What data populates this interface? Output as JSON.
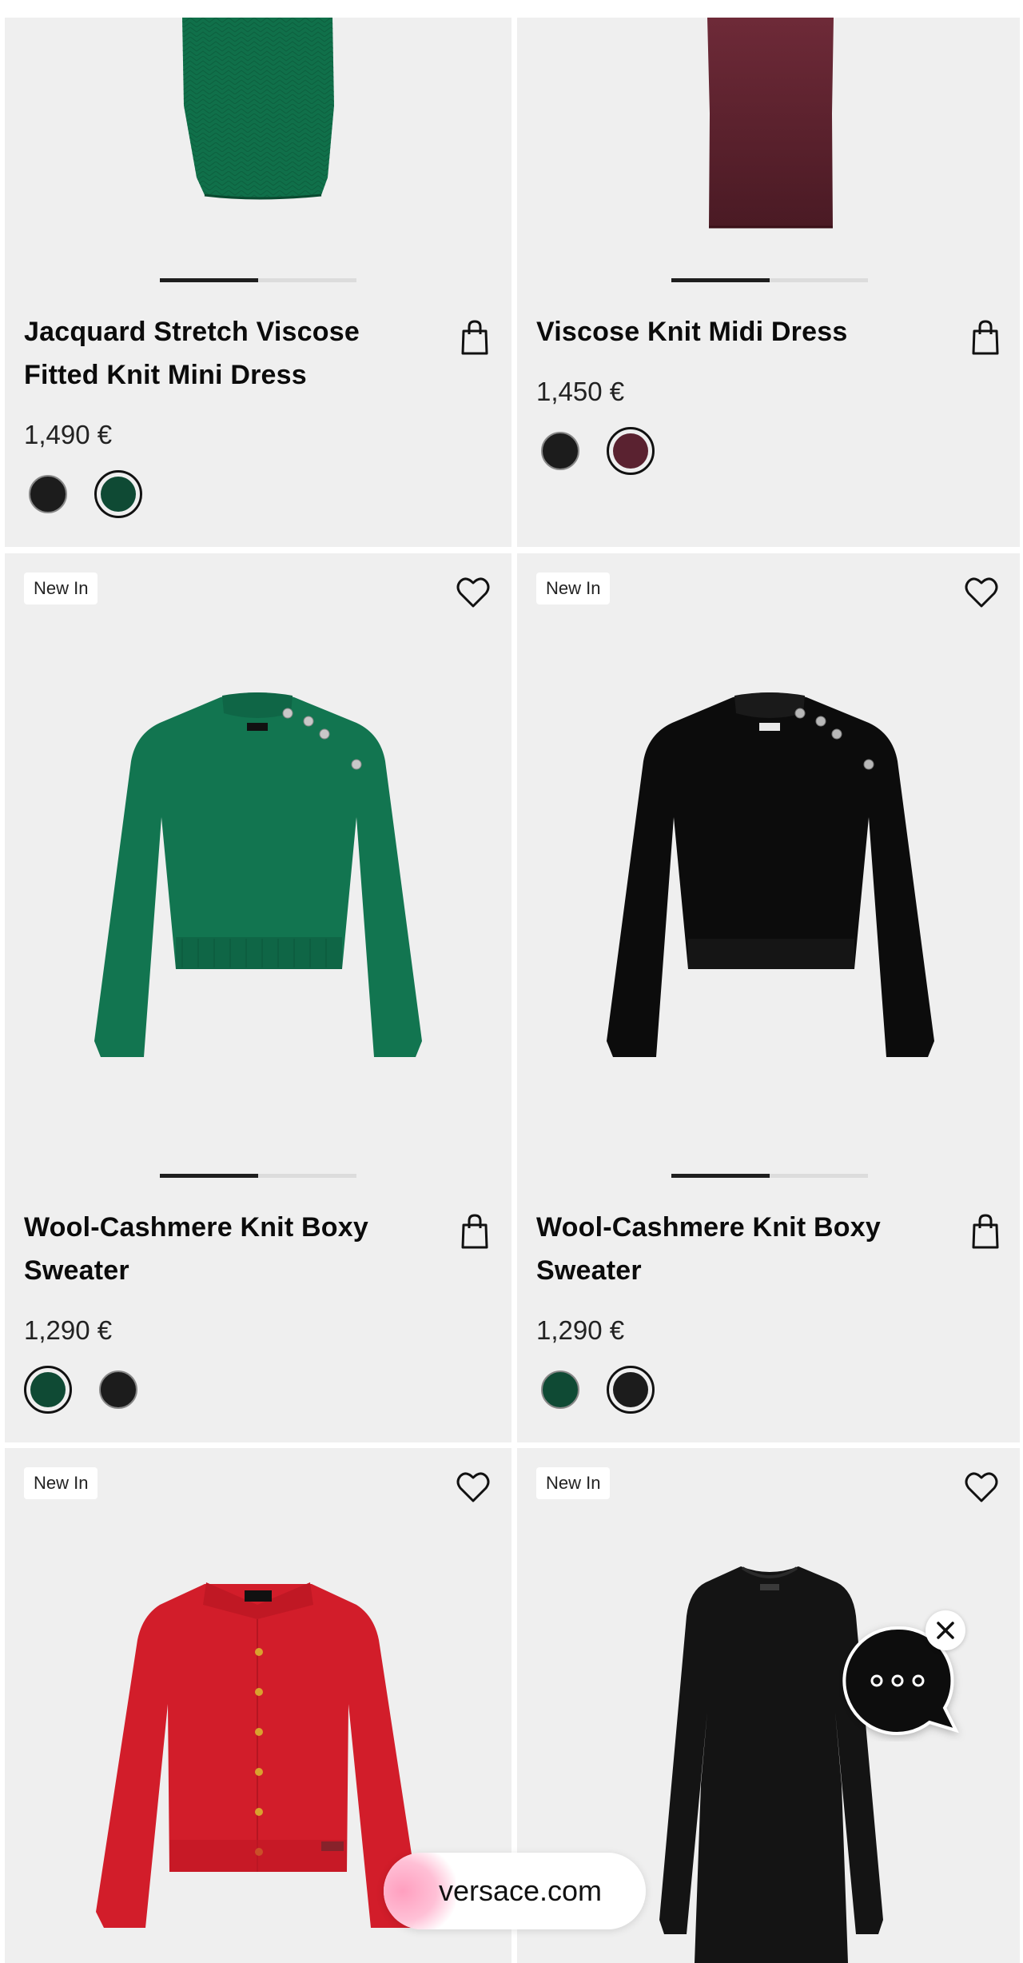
{
  "products": [
    {
      "name": "Jacquard Stretch Viscose Fitted Knit Mini Dress",
      "price": "1,490 €",
      "badge": "",
      "image": "green-knit-mini-dress",
      "swatches": [
        {
          "color": "#1c1c1c",
          "selected": false
        },
        {
          "color": "#0f4a34",
          "selected": true
        }
      ]
    },
    {
      "name": "Viscose Knit Midi Dress",
      "price": "1,450 €",
      "badge": "",
      "image": "burgundy-knit-midi-dress",
      "swatches": [
        {
          "color": "#1c1c1c",
          "selected": false
        },
        {
          "color": "#5a2230",
          "selected": true
        }
      ]
    },
    {
      "name": "Wool-Cashmere Knit Boxy Sweater",
      "price": "1,290 €",
      "badge": "New In",
      "image": "green-boxy-sweater",
      "swatches": [
        {
          "color": "#0f4a34",
          "selected": true
        },
        {
          "color": "#1c1c1c",
          "selected": false
        }
      ]
    },
    {
      "name": "Wool-Cashmere Knit Boxy Sweater",
      "price": "1,290 €",
      "badge": "New In",
      "image": "black-boxy-sweater",
      "swatches": [
        {
          "color": "#0f4a34",
          "selected": false
        },
        {
          "color": "#1c1c1c",
          "selected": true
        }
      ]
    },
    {
      "name": "",
      "price": "",
      "badge": "New In",
      "image": "red-cardigan",
      "swatches": []
    },
    {
      "name": "",
      "price": "",
      "badge": "New In",
      "image": "black-knit-dress",
      "swatches": []
    }
  ],
  "carousel_progress": [
    0.5,
    0.5,
    0.5,
    0.5
  ],
  "browser": {
    "url": "versace.com"
  },
  "chat_widget": {
    "icon": "chat-bubble-icon",
    "close_icon": "close-icon"
  },
  "colors": {
    "card_bg": "#efefef",
    "progress_active": "#1e1e1e",
    "progress_track": "#dcdcdc"
  }
}
